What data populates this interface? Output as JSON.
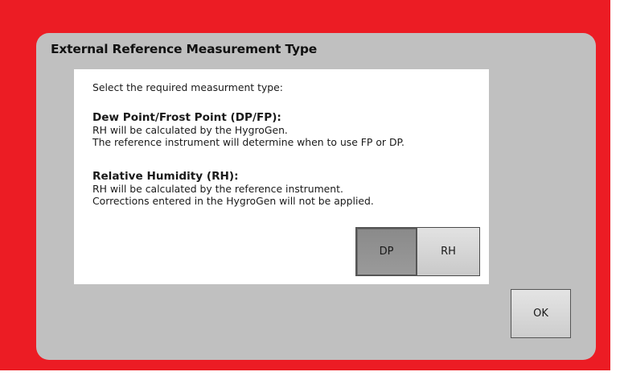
{
  "colors": {
    "frame": "#ec1c24",
    "panel": "#c0c0c0",
    "content": "#ffffff",
    "selected_button": "#8f8f8f",
    "button": "#d6d6d6"
  },
  "dialog": {
    "title": "External Reference Measurement Type",
    "prompt": "Select the required measurment type:",
    "sections": [
      {
        "heading": "Dew Point/Frost Point (DP/FP):",
        "lines": [
          "RH will be calculated by the HygroGen.",
          "The reference instrument will determine when to use FP or DP."
        ]
      },
      {
        "heading": "Relative Humidity (RH):",
        "lines": [
          "RH will be calculated by the reference instrument.",
          "Corrections entered in the HygroGen will not be applied."
        ]
      }
    ],
    "options": {
      "selected": "DP",
      "dp_label": "DP",
      "rh_label": "RH"
    },
    "ok_label": "OK"
  }
}
